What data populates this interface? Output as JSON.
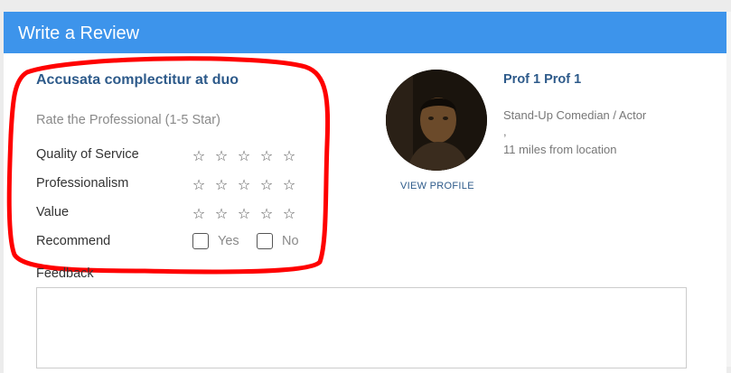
{
  "header": {
    "title": "Write a Review"
  },
  "review": {
    "title": "Accusata complectitur at duo",
    "rate_heading": "Rate the Professional (1-5 Star)",
    "ratings": [
      {
        "label": "Quality of Service",
        "stars": 0,
        "max": 5
      },
      {
        "label": "Professionalism",
        "stars": 0,
        "max": 5
      },
      {
        "label": "Value",
        "stars": 0,
        "max": 5
      }
    ],
    "recommend": {
      "label": "Recommend",
      "options": [
        {
          "label": "Yes",
          "checked": false
        },
        {
          "label": "No",
          "checked": false
        }
      ]
    },
    "star_glyph": "☆"
  },
  "professional": {
    "name": "Prof 1 Prof 1",
    "role": "Stand-Up Comedian / Actor",
    "separator": ",",
    "distance": "11 miles from location",
    "view_profile_label": "VIEW PROFILE"
  },
  "feedback": {
    "label": "Feedback",
    "value": ""
  },
  "colors": {
    "header_bg": "#3d94eb",
    "accent_text": "#2d5a8a",
    "annotation": "#ff0000"
  }
}
